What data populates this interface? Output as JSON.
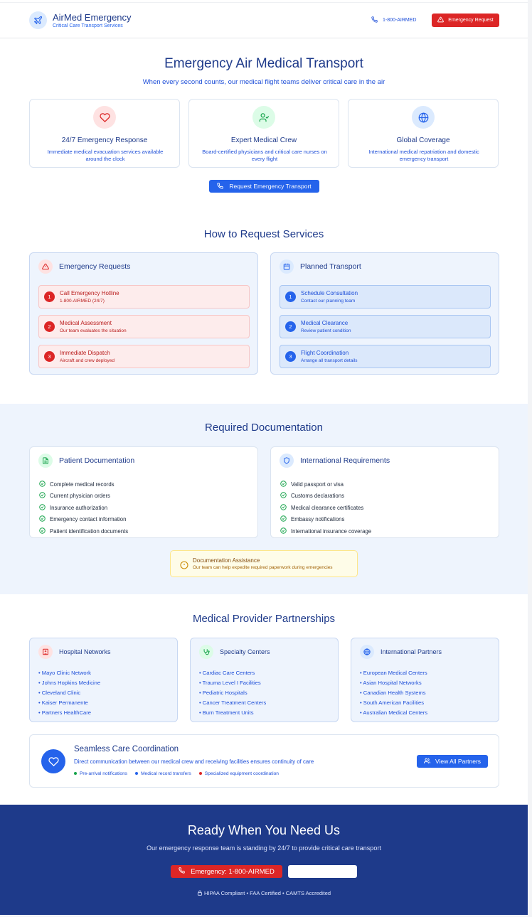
{
  "header": {
    "brand_title": "AirMed Emergency",
    "brand_subtitle": "Critical Care Transport Services",
    "phone": "1-800-AIRMED",
    "emergency_button": "Emergency Request"
  },
  "hero": {
    "title": "Emergency Air Medical Transport",
    "subtitle": "When every second counts, our medical flight teams deliver critical care in the air",
    "features": [
      {
        "title": "24/7 Emergency Response",
        "desc": "Immediate medical evacuation services available around the clock",
        "icon": "heart-icon"
      },
      {
        "title": "Expert Medical Crew",
        "desc": "Board-certified physicians and critical care nurses on every flight",
        "icon": "user-check-icon"
      },
      {
        "title": "Global Coverage",
        "desc": "International medical repatriation and domestic emergency transport",
        "icon": "globe-icon"
      }
    ],
    "cta": "Request Emergency Transport"
  },
  "request": {
    "title": "How to Request Services",
    "emergency": {
      "heading": "Emergency Requests",
      "steps": [
        {
          "num": "1",
          "title": "Call Emergency Hotline",
          "desc": "1-800-AIRMED (24/7)"
        },
        {
          "num": "2",
          "title": "Medical Assessment",
          "desc": "Our team evaluates the situation"
        },
        {
          "num": "3",
          "title": "Immediate Dispatch",
          "desc": "Aircraft and crew deployed"
        }
      ]
    },
    "planned": {
      "heading": "Planned Transport",
      "steps": [
        {
          "num": "1",
          "title": "Schedule Consultation",
          "desc": "Contact our planning team"
        },
        {
          "num": "2",
          "title": "Medical Clearance",
          "desc": "Review patient condition"
        },
        {
          "num": "3",
          "title": "Flight Coordination",
          "desc": "Arrange all transport details"
        }
      ]
    }
  },
  "docs": {
    "title": "Required Documentation",
    "patient": {
      "heading": "Patient Documentation",
      "items": [
        "Complete medical records",
        "Current physician orders",
        "Insurance authorization",
        "Emergency contact information",
        "Patient identification documents"
      ]
    },
    "international": {
      "heading": "International Requirements",
      "items": [
        "Valid passport or visa",
        "Customs declarations",
        "Medical clearance certificates",
        "Embassy notifications",
        "International insurance coverage"
      ]
    },
    "assist_title": "Documentation Assistance",
    "assist_desc": "Our team can help expedite required paperwork during emergencies"
  },
  "partners": {
    "title": "Medical Provider Partnerships",
    "groups": [
      {
        "heading": "Hospital Networks",
        "items": [
          "• Mayo Clinic Network",
          "• Johns Hopkins Medicine",
          "• Cleveland Clinic",
          "• Kaiser Permanente",
          "• Partners HealthCare"
        ]
      },
      {
        "heading": "Specialty Centers",
        "items": [
          "• Cardiac Care Centers",
          "• Trauma Level I Facilities",
          "• Pediatric Hospitals",
          "• Cancer Treatment Centers",
          "• Burn Treatment Units"
        ]
      },
      {
        "heading": "International Partners",
        "items": [
          "• European Medical Centers",
          "• Asian Hospital Networks",
          "• Canadian Health Systems",
          "• South American Facilities",
          "• Australian Medical Centers"
        ]
      }
    ],
    "coord_title": "Seamless Care Coordination",
    "coord_desc": "Direct communication between our medical crew and receiving facilities ensures continuity of care",
    "coord_bullets": [
      "Pre-arrival notifications",
      "Medical record transfers",
      "Specialized equipment coordination"
    ],
    "view_all": "View All Partners"
  },
  "footer": {
    "title": "Ready When You Need Us",
    "desc": "Our emergency response team is standing by 24/7 to provide critical care transport",
    "emergency_button": "Emergency: 1-800-AIRMED",
    "compliance": "HIPAA Compliant • FAA Certified • CAMTS Accredited"
  },
  "colors": {
    "primary": "#2563eb",
    "navy": "#1e3a8a",
    "emergency": "#dc2626",
    "success": "#16a34a"
  }
}
